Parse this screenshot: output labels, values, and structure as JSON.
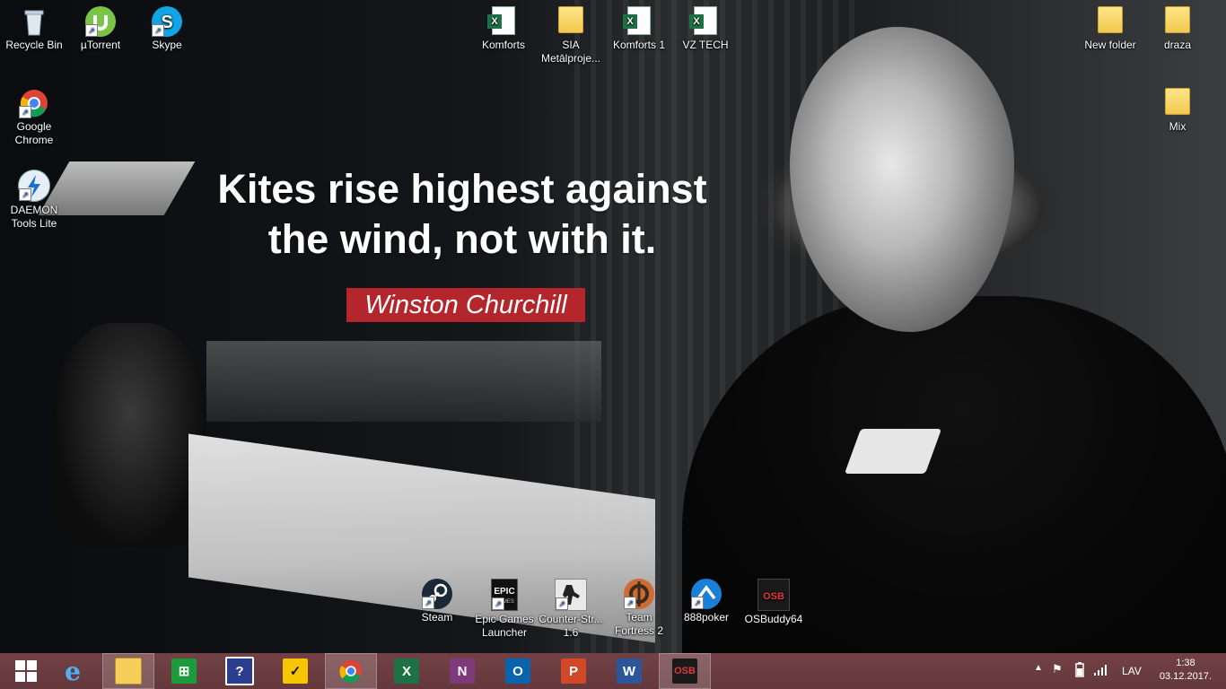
{
  "wallpaper": {
    "quote_line1": "Kites rise highest against",
    "quote_line2": "the wind, not with it.",
    "author": "Winston Churchill",
    "accent_color": "#b3262c"
  },
  "desktop_icons": {
    "recycle_bin": "Recycle Bin",
    "utorrent": "µTorrent",
    "skype": "Skype",
    "chrome": "Google Chrome",
    "daemon": "DAEMON Tools Lite",
    "komforts": "Komforts",
    "sia": "SIA Metālproje...",
    "komforts1": "Komforts 1",
    "vztech": "VZ TECH",
    "new_folder": "New folder",
    "draza": "draza",
    "mix": "Mix",
    "steam": "Steam",
    "epic": "Epic Games Launcher",
    "cs": "Counter-Str... 1.6",
    "tf2": "Team Fortress 2",
    "poker": "888poker",
    "osbuddy": "OSBuddy64"
  },
  "taskbar": {
    "pinned": [
      "windows-start",
      "internet-explorer",
      "file-explorer",
      "windows-store",
      "help",
      "norton",
      "google-chrome",
      "excel",
      "onenote",
      "outlook",
      "powerpoint",
      "word",
      "osbuddy"
    ],
    "tray": {
      "language": "LAV",
      "time": "1:38",
      "date": "03.12.2017."
    }
  }
}
